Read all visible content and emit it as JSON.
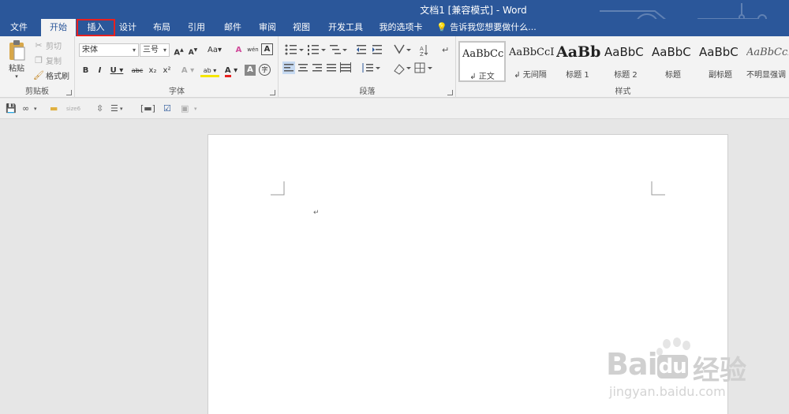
{
  "window": {
    "title": "文档1 [兼容模式] - Word"
  },
  "tabs": [
    {
      "label": "文件"
    },
    {
      "label": "开始"
    },
    {
      "label": "插入"
    },
    {
      "label": "设计"
    },
    {
      "label": "布局"
    },
    {
      "label": "引用"
    },
    {
      "label": "邮件"
    },
    {
      "label": "审阅"
    },
    {
      "label": "视图"
    },
    {
      "label": "开发工具"
    },
    {
      "label": "我的选项卡"
    }
  ],
  "tell_me": {
    "placeholder": "告诉我您想要做什么..."
  },
  "clipboard": {
    "paste": "粘贴",
    "cut": "剪切",
    "copy": "复制",
    "format_painter": "格式刷",
    "group_label": "剪贴板"
  },
  "font": {
    "name": "宋体",
    "size": "三号",
    "grow": "A",
    "shrink": "A",
    "case": "Aa",
    "clear": "A",
    "phonetic": "wén",
    "border": "A",
    "bold": "B",
    "italic": "I",
    "underline": "U",
    "strike": "abc",
    "subscript": "x₂",
    "superscript": "x²",
    "effects": "A",
    "highlight": "ab",
    "color": "A",
    "shade": "A",
    "enclose": "字",
    "group_label": "字体"
  },
  "paragraph": {
    "group_label": "段落"
  },
  "styles": {
    "items": [
      {
        "sample": "AaBbCcDd",
        "name": "↲ 正文"
      },
      {
        "sample": "AaBbCcDd",
        "name": "↲ 无间隔"
      },
      {
        "sample": "AaBb",
        "name": "标题 1"
      },
      {
        "sample": "AaBbC",
        "name": "标题 2"
      },
      {
        "sample": "AaBbC",
        "name": "标题"
      },
      {
        "sample": "AaBbC",
        "name": "副标题"
      },
      {
        "sample": "AaBbCcDd",
        "name": "不明显强调"
      }
    ],
    "group_label": "样式"
  },
  "qat": {
    "size_label": "size6"
  },
  "document": {
    "paragraph_mark": "↵"
  },
  "watermark": {
    "brand": "Bai",
    "brand2": "du",
    "cn": "经验",
    "url": "jingyan.baidu.com"
  },
  "colors": {
    "accent": "#2b579a",
    "highlight_box": "#e8201f",
    "font_color": "#e8201f",
    "highlight_color": "#f5e600"
  }
}
